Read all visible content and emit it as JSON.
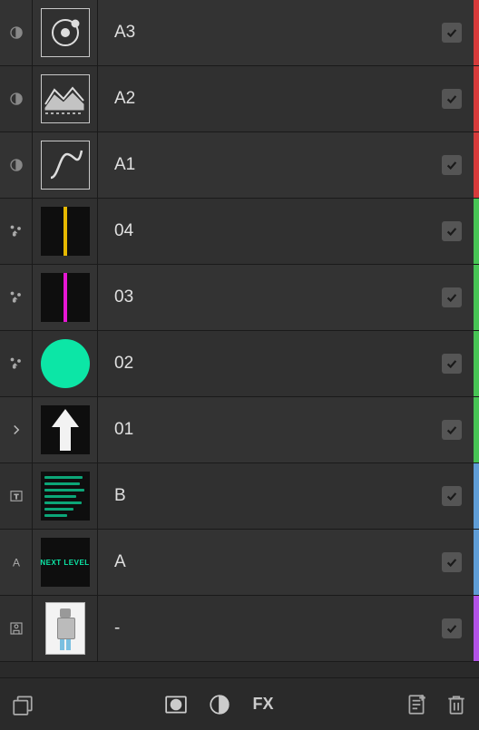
{
  "layers": [
    {
      "id": "a3",
      "label": "A3",
      "left_icon": "adjustment",
      "thumb": "orbit",
      "color": "#d63b3b",
      "checked": true
    },
    {
      "id": "a2",
      "label": "A2",
      "left_icon": "adjustment",
      "thumb": "areachart",
      "color": "#d63b3b",
      "checked": true
    },
    {
      "id": "a1",
      "label": "A1",
      "left_icon": "adjustment",
      "thumb": "curve",
      "color": "#d63b3b",
      "checked": true
    },
    {
      "id": "04",
      "label": "04",
      "left_icon": "nodes",
      "thumb": "vline_yellow",
      "color": "#47c455",
      "checked": true
    },
    {
      "id": "03",
      "label": "03",
      "left_icon": "nodes",
      "thumb": "vline_magenta",
      "color": "#47c455",
      "checked": true
    },
    {
      "id": "02",
      "label": "02",
      "left_icon": "nodes",
      "thumb": "circle_teal",
      "color": "#47c455",
      "checked": true
    },
    {
      "id": "01",
      "label": "01",
      "left_icon": "chevron",
      "thumb": "arrow_up",
      "color": "#47c455",
      "checked": true
    },
    {
      "id": "b",
      "label": "B",
      "left_icon": "textbox",
      "thumb": "text_lines",
      "color": "#5f9dd6",
      "checked": true
    },
    {
      "id": "a",
      "label": "A",
      "left_icon": "textglyph",
      "thumb": "next_level",
      "thumb_text": "NEXT LEVEL",
      "color": "#5f9dd6",
      "checked": true
    },
    {
      "id": "img",
      "label": "-",
      "left_icon": "imagebox",
      "thumb": "robot",
      "color": "#b253e6",
      "checked": true
    }
  ],
  "toolbar": {
    "group_icon": "group",
    "mask_icon": "mask",
    "adjust_icon": "adjustment",
    "fx_label": "FX",
    "newpage_icon": "new-page",
    "trash_icon": "trash"
  }
}
